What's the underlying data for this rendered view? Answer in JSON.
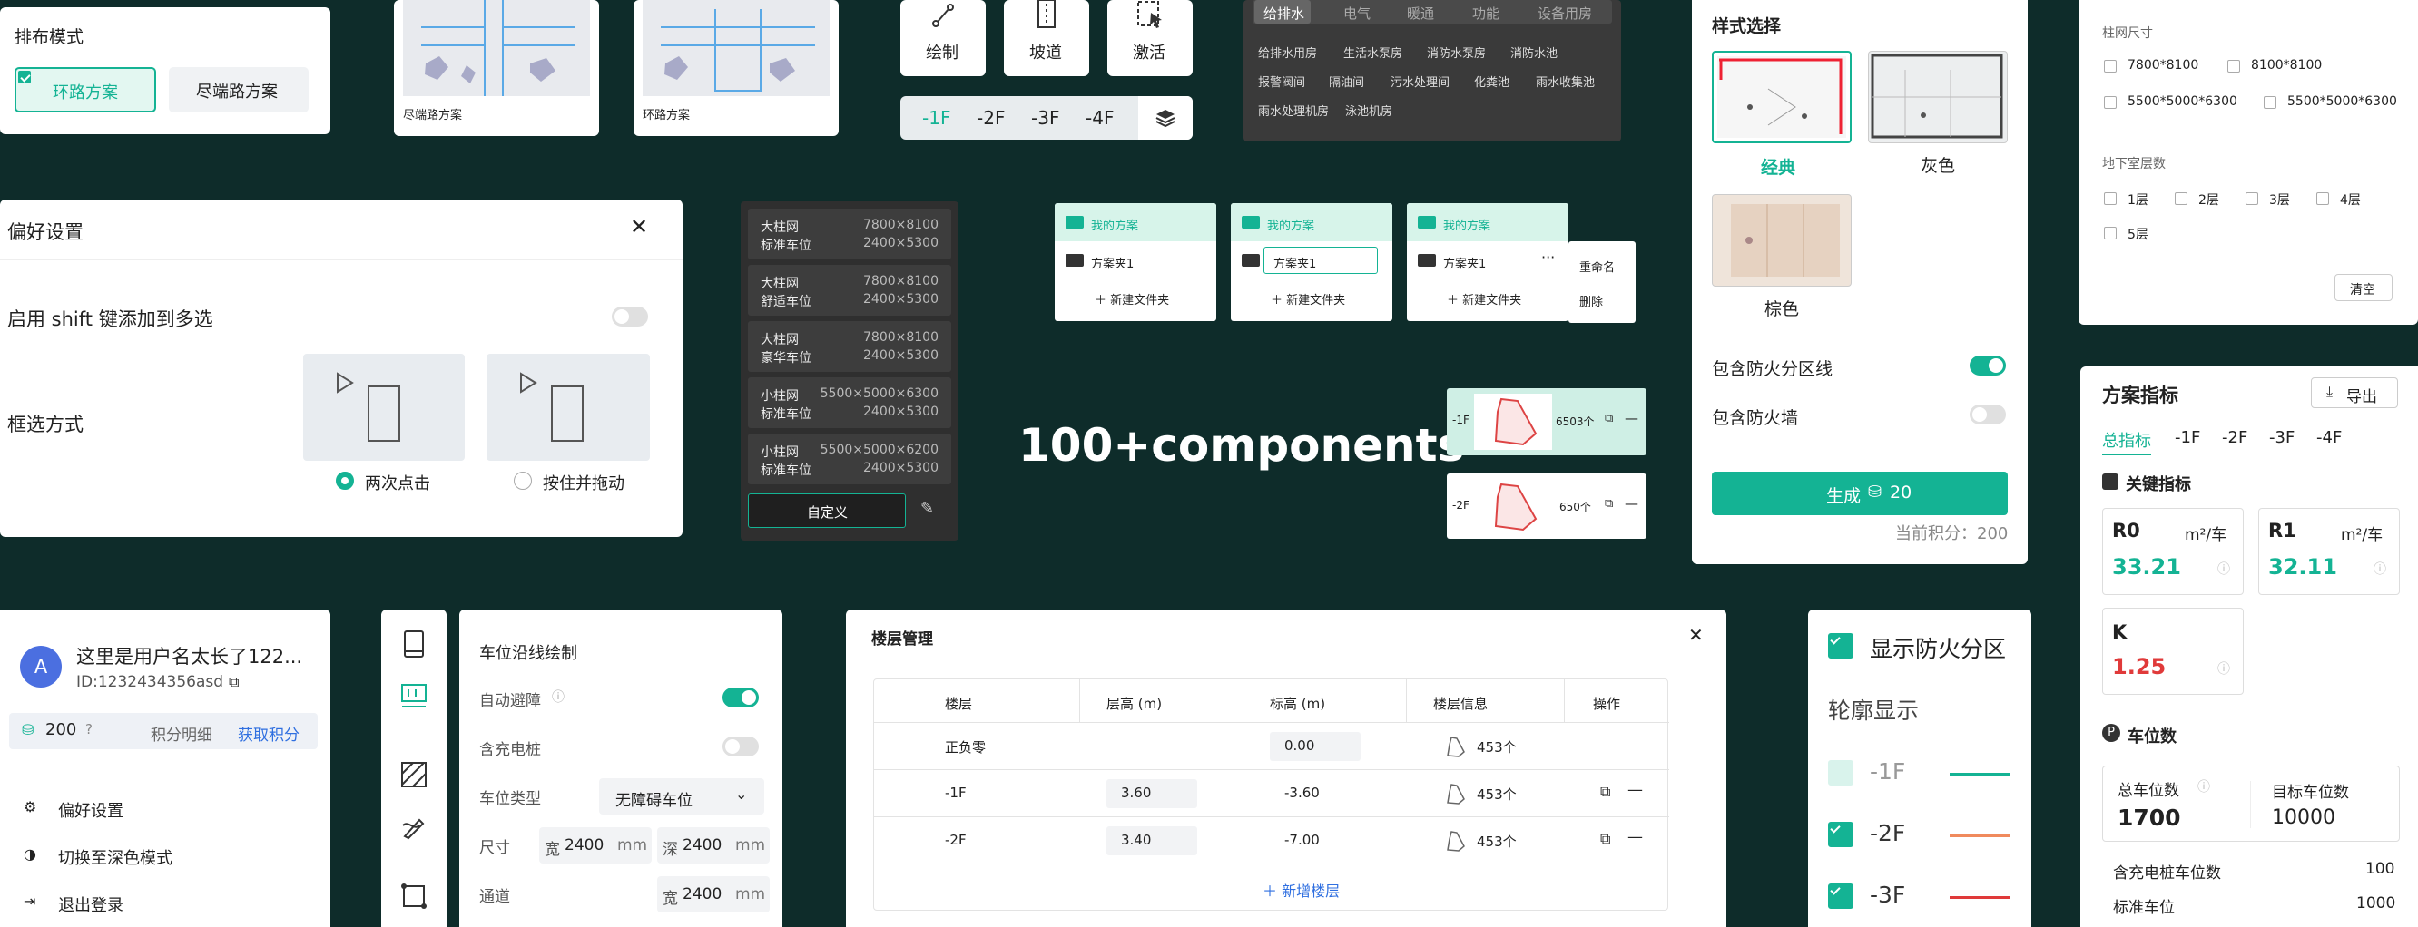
{
  "layout_panel": {
    "title": "排布模式",
    "opt1": "环路方案",
    "opt2": "尽端路方案"
  },
  "thumbs": {
    "t1": "尽端路方案",
    "t2": "环路方案"
  },
  "tools": {
    "draw": "绘制",
    "ramp": "坡道",
    "activate": "激活",
    "floors": [
      "-1F",
      "-2F",
      "-3F",
      "-4F"
    ]
  },
  "tags": {
    "tabs": [
      "给排水",
      "电气",
      "暖通",
      "功能",
      "设备用房"
    ],
    "row1": [
      "给排水用房",
      "生活水泵房",
      "消防水泵房",
      "消防水池"
    ],
    "row2": [
      "报警阀间",
      "隔油间",
      "污水处理间",
      "化粪池",
      "雨水收集池"
    ],
    "row3": [
      "雨水处理机房",
      "泳池机房"
    ]
  },
  "pref": {
    "title": "偏好设置",
    "shift_label": "启用 shift 键添加到多选",
    "select_label": "框选方式",
    "opt1": "两次点击",
    "opt2": "按住并拖动"
  },
  "grid_list": {
    "items": [
      {
        "n1": "大柱网",
        "n2": "标准车位",
        "s1": "7800×8100",
        "s2": "2400×5300"
      },
      {
        "n1": "大柱网",
        "n2": "舒适车位",
        "s1": "7800×8100",
        "s2": "2400×5300"
      },
      {
        "n1": "大柱网",
        "n2": "豪华车位",
        "s1": "7800×8100",
        "s2": "2400×5300"
      },
      {
        "n1": "小柱网",
        "n2": "标准车位",
        "s1": "5500×5000×6300",
        "s2": "2400×5300"
      },
      {
        "n1": "小柱网",
        "n2": "标准车位",
        "s1": "5500×5000×6200",
        "s2": "2400×5300"
      }
    ],
    "custom": "自定义"
  },
  "folders": {
    "my": "我的方案",
    "folder1": "方案夹1",
    "newfolder": "新建文件夹",
    "rename": "重命名",
    "delete": "删除"
  },
  "hero": "100+components",
  "floorcards": {
    "c1": {
      "floor": "-1F",
      "count": "6503个"
    },
    "c2": {
      "floor": "-2F",
      "count": "650个"
    }
  },
  "style": {
    "title": "样式选择",
    "classic": "经典",
    "gray": "灰色",
    "brown": "棕色",
    "line_label": "包含防火分区线",
    "wall_label": "包含防火墙",
    "gen": "生成",
    "gen_cost": "20",
    "points": "当前积分：200"
  },
  "filter": {
    "grid_title": "柱网尺寸",
    "grid_opts": [
      "7800*8100",
      "8100*8100",
      "5500*5000*6300",
      "5500*5000*6300"
    ],
    "base_title": "地下室层数",
    "base_opts": [
      "1层",
      "2层",
      "3层",
      "4层",
      "5层"
    ],
    "clear": "清空"
  },
  "metrics": {
    "title": "方案指标",
    "export": "导出",
    "tabs": [
      "总指标",
      "-1F",
      "-2F",
      "-3F",
      "-4F"
    ],
    "key": "关键指标",
    "r0": "R0",
    "r1": "R1",
    "unit": "m²/车",
    "r0v": "33.21",
    "r1v": "32.11",
    "k": "K",
    "kv": "1.25",
    "parking": "车位数",
    "total_label": "总车位数",
    "total": "1700",
    "target_label": "目标车位数",
    "target": "10000",
    "ev_label": "含充电桩车位数",
    "ev": "100",
    "std_label": "标准车位",
    "std": "1000"
  },
  "user": {
    "avatar": "A",
    "name": "这里是用户名太长了122...",
    "id": "ID:1232434356asd",
    "points": "200",
    "detail": "积分明细",
    "get": "获取积分",
    "menu": [
      "偏好设置",
      "切换至深色模式",
      "退出登录"
    ]
  },
  "edge": {
    "title": "车位沿线绘制",
    "avoid": "自动避障",
    "ev": "含充电桩",
    "type_label": "车位类型",
    "type_val": "无障碍车位",
    "size_label": "尺寸",
    "w": "宽",
    "d": "深",
    "wv": "2400",
    "dv": "2400",
    "mm": "mm",
    "lane": "通道",
    "lv": "2400"
  },
  "floors_mgmt": {
    "title": "楼层管理",
    "headers": [
      "楼层",
      "层高 (m)",
      "标高 (m)",
      "楼层信息",
      "操作"
    ],
    "rows": [
      {
        "name": "正负零",
        "h": "",
        "e": "0.00",
        "info": "453个"
      },
      {
        "name": "-1F",
        "h": "3.60",
        "e": "-3.60",
        "info": "453个"
      },
      {
        "name": "-2F",
        "h": "3.40",
        "e": "-7.00",
        "info": "453个"
      }
    ],
    "add": "新增楼层"
  },
  "fire": {
    "show": "显示防火分区",
    "outline": "轮廓显示",
    "floors": [
      {
        "f": "-1F",
        "color": "#14b394",
        "on": false
      },
      {
        "f": "-2F",
        "color": "#f08a5d",
        "on": true
      },
      {
        "f": "-3F",
        "color": "#e03a3a",
        "on": true
      }
    ]
  },
  "colors": {
    "accent": "#14b394",
    "bg": "#0e2c2a"
  }
}
